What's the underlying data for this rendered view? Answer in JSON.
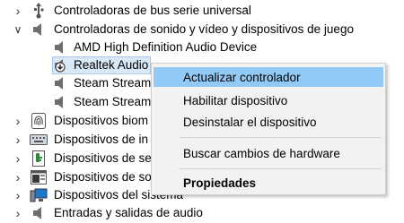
{
  "tree": {
    "rows": [
      {
        "label": "Controladoras de bus serie universal",
        "icon": "usb-icon",
        "expander": "collapsed"
      },
      {
        "label": "Controladoras de sonido y vídeo y dispositivos de juego",
        "icon": "speaker-icon",
        "expander": "expanded"
      },
      {
        "label": "AMD High Definition Audio Device",
        "icon": "speaker-icon",
        "expander": "none"
      },
      {
        "label": "Realtek Audio",
        "icon": "speaker-warning-icon",
        "expander": "none",
        "selected": true
      },
      {
        "label": "Steam Streami",
        "icon": "speaker-icon",
        "expander": "none"
      },
      {
        "label": "Steam Streami",
        "icon": "speaker-icon",
        "expander": "none"
      },
      {
        "label": "Dispositivos biom",
        "icon": "fingerprint-icon",
        "expander": "collapsed"
      },
      {
        "label": "Dispositivos de in",
        "icon": "keyboard-icon",
        "expander": "collapsed"
      },
      {
        "label": "Dispositivos de se",
        "icon": "security-key-icon",
        "expander": "collapsed"
      },
      {
        "label": "Dispositivos de so",
        "icon": "software-device-icon",
        "expander": "collapsed"
      },
      {
        "label": "Dispositivos del sistema",
        "icon": "system-device-icon",
        "expander": "collapsed"
      },
      {
        "label": "Entradas y salidas de audio",
        "icon": "audio-io-icon",
        "expander": "collapsed"
      }
    ]
  },
  "context_menu": {
    "items": [
      {
        "label": "Actualizar controlador",
        "highlighted": true
      },
      {
        "label": "Habilitar dispositivo"
      },
      {
        "label": "Desinstalar el dispositivo"
      },
      {
        "label": "Buscar cambios de hardware"
      },
      {
        "label": "Propiedades",
        "bold": true
      }
    ]
  },
  "colors": {
    "selection": "#d9e8f7",
    "menu_highlight": "#91c9f7",
    "menu_background": "#f2f2f2"
  }
}
